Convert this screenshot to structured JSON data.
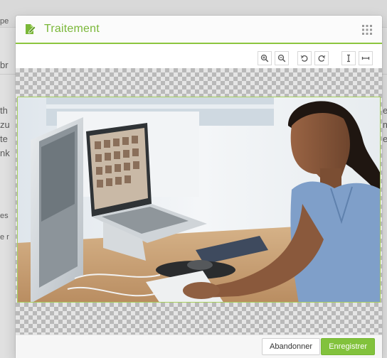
{
  "background_page": {
    "text_fragments": [
      "pe",
      "br",
      "th",
      "zu",
      "te",
      "nk",
      "es",
      "e r",
      "e",
      "m",
      "e"
    ]
  },
  "modal": {
    "title": "Traitement",
    "header_icon": "document-edit-icon",
    "apps_icon": "grid-icon",
    "accent_color": "#8cc63e",
    "title_color": "#7ab738",
    "toolbar": {
      "buttons": [
        {
          "name": "zoom-in",
          "icon": "zoom-in-icon"
        },
        {
          "name": "zoom-out",
          "icon": "zoom-out-icon"
        },
        {
          "name": "rotate-left",
          "icon": "rotate-left-icon"
        },
        {
          "name": "rotate-right",
          "icon": "rotate-right-icon"
        },
        {
          "name": "flip-vertical",
          "icon": "flip-vertical-icon"
        },
        {
          "name": "flip-horizontal",
          "icon": "flip-horizontal-icon"
        }
      ]
    },
    "image": {
      "subject": "woman-at-computer-photo"
    },
    "footer": {
      "cancel_label": "Abandonner",
      "save_label": "Enregistrer",
      "save_color": "#82c23c"
    }
  }
}
